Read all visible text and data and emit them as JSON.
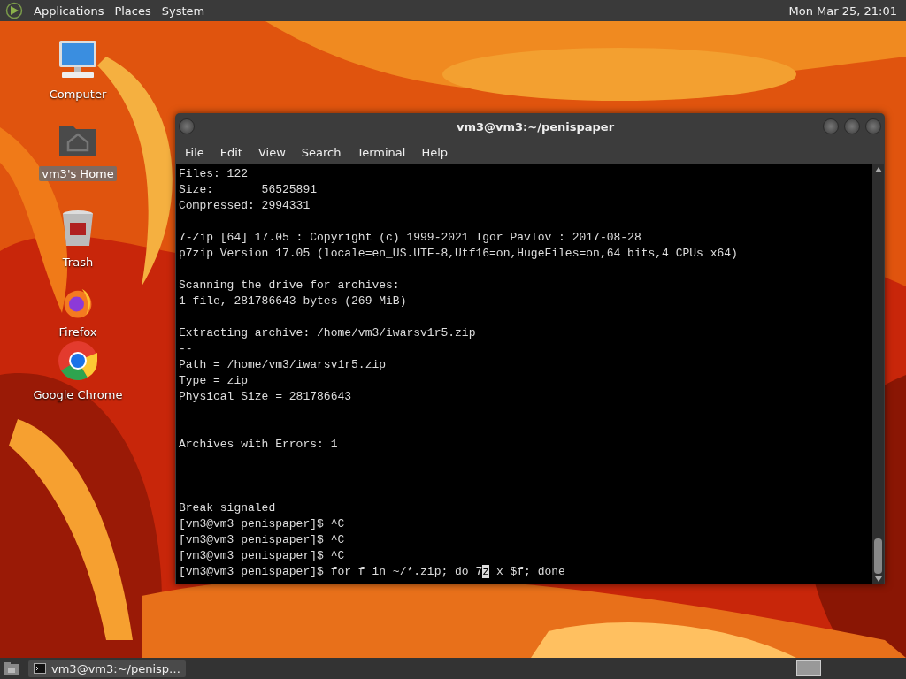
{
  "top_panel": {
    "menus": [
      "Applications",
      "Places",
      "System"
    ],
    "clock": "Mon Mar 25, 21:01"
  },
  "desktop_icons": [
    {
      "kind": "computer",
      "label": "Computer",
      "selected": false
    },
    {
      "kind": "home",
      "label": "vm3's Home",
      "selected": true
    },
    {
      "kind": "trash",
      "label": "Trash",
      "selected": false
    },
    {
      "kind": "firefox",
      "label": "Firefox",
      "selected": false
    },
    {
      "kind": "chrome",
      "label": "Google Chrome",
      "selected": false
    }
  ],
  "window": {
    "title": "vm3@vm3:~/penispaper",
    "menu": [
      "File",
      "Edit",
      "View",
      "Search",
      "Terminal",
      "Help"
    ],
    "terminal_blocks": [
      {
        "lines": [
          "Files: 122",
          "Size:       56525891",
          "Compressed: 2994331"
        ]
      },
      {
        "lines": [
          "7-Zip [64] 17.05 : Copyright (c) 1999-2021 Igor Pavlov : 2017-08-28",
          "p7zip Version 17.05 (locale=en_US.UTF-8,Utf16=on,HugeFiles=on,64 bits,4 CPUs x64)"
        ]
      },
      {
        "lines": [
          "Scanning the drive for archives:",
          "1 file, 281786643 bytes (269 MiB)"
        ]
      },
      {
        "lines": [
          "Extracting archive: /home/vm3/iwarsv1r5.zip",
          "--",
          "Path = /home/vm3/iwarsv1r5.zip",
          "Type = zip",
          "Physical Size = 281786643"
        ]
      },
      {
        "lines": [
          "Archives with Errors: 1"
        ]
      },
      {
        "lines": [
          "Break signaled",
          "[vm3@vm3 penispaper]$ ^C",
          "[vm3@vm3 penispaper]$ ^C",
          "[vm3@vm3 penispaper]$ ^C"
        ]
      }
    ],
    "input_line": {
      "before": "[vm3@vm3 penispaper]$ for f in ~/*.zip; do 7",
      "cursor": "z",
      "after": " x $f; done"
    }
  },
  "taskbar": {
    "tasks": [
      {
        "label": "vm3@vm3:~/penisp…",
        "selected": false
      }
    ]
  }
}
